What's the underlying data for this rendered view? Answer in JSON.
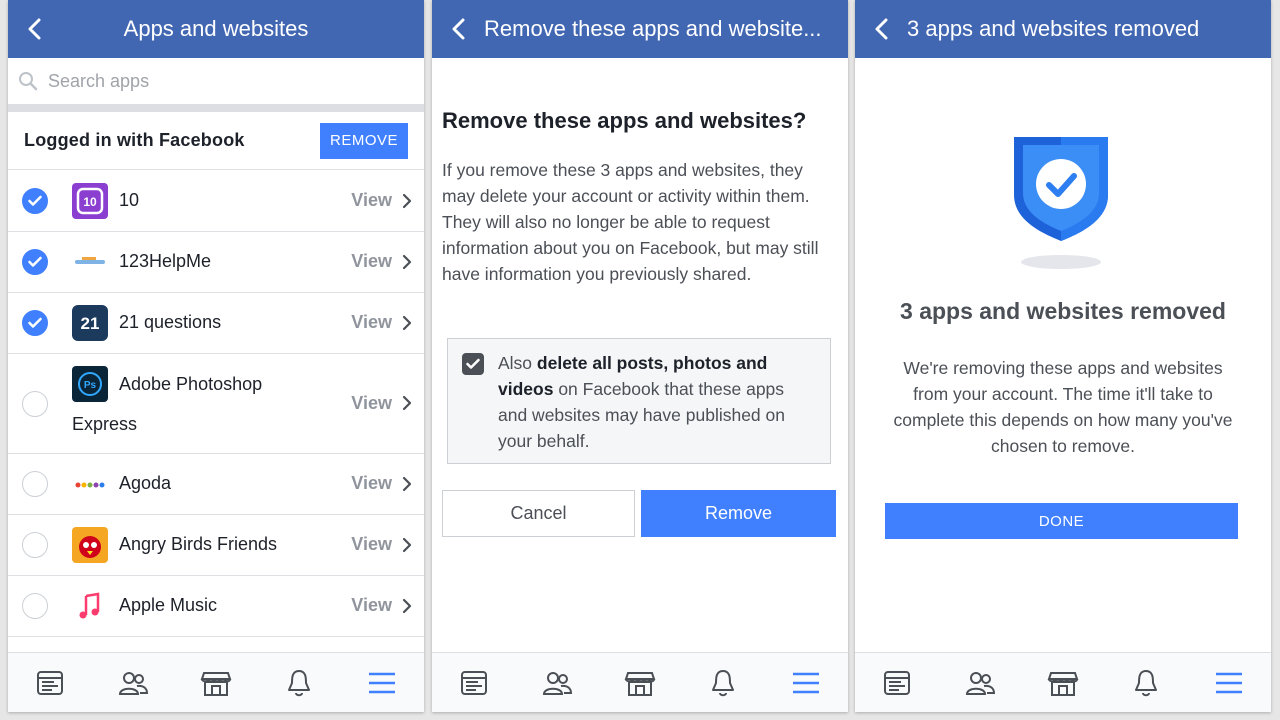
{
  "panel1": {
    "header_title": "Apps and websites",
    "search_placeholder": "Search apps",
    "section_title": "Logged in with Facebook",
    "remove_button": "REMOVE",
    "apps": [
      {
        "name": "10",
        "name2": "",
        "checked": true,
        "view": "View",
        "icon": "ten-app-icon"
      },
      {
        "name": "123HelpMe",
        "name2": "",
        "checked": true,
        "view": "View",
        "icon": "123helpme-app-icon"
      },
      {
        "name": "21 questions",
        "name2": "",
        "checked": true,
        "view": "View",
        "icon": "21-questions-app-icon"
      },
      {
        "name": "Adobe Photoshop",
        "name2": "Express",
        "checked": false,
        "view": "View",
        "icon": "photoshop-express-app-icon"
      },
      {
        "name": "Agoda",
        "name2": "",
        "checked": false,
        "view": "View",
        "icon": "agoda-app-icon"
      },
      {
        "name": "Angry Birds Friends",
        "name2": "",
        "checked": false,
        "view": "View",
        "icon": "angry-birds-app-icon"
      },
      {
        "name": "Apple Music",
        "name2": "",
        "checked": false,
        "view": "View",
        "icon": "apple-music-app-icon"
      }
    ]
  },
  "panel2": {
    "header_title": "Remove these apps and website...",
    "heading": "Remove these apps and websites?",
    "paragraph": "If you remove these 3 apps and websites, they may delete your account or activity within them. They will also no longer be able to request information about you on Facebook, but may still have information you previously shared.",
    "option_prefix": "Also ",
    "option_bold": "delete all posts, photos and videos",
    "option_suffix": " on Facebook that these apps and websites may have published on your behalf.",
    "option_checked": true,
    "cancel_label": "Cancel",
    "remove_label": "Remove"
  },
  "panel3": {
    "header_title": "3 apps and websites removed",
    "heading": "3 apps and websites removed",
    "paragraph": "We're removing these apps and websites from your account. The time it'll take to complete this depends on how many you've chosen to remove.",
    "done_label": "DONE"
  },
  "tabbar": [
    "news-feed-icon",
    "friends-icon",
    "marketplace-icon",
    "notifications-bell-icon",
    "menu-icon"
  ],
  "colors": {
    "header": "#4267b2",
    "accent": "#4080ff",
    "active_tab": "#4080ff"
  }
}
